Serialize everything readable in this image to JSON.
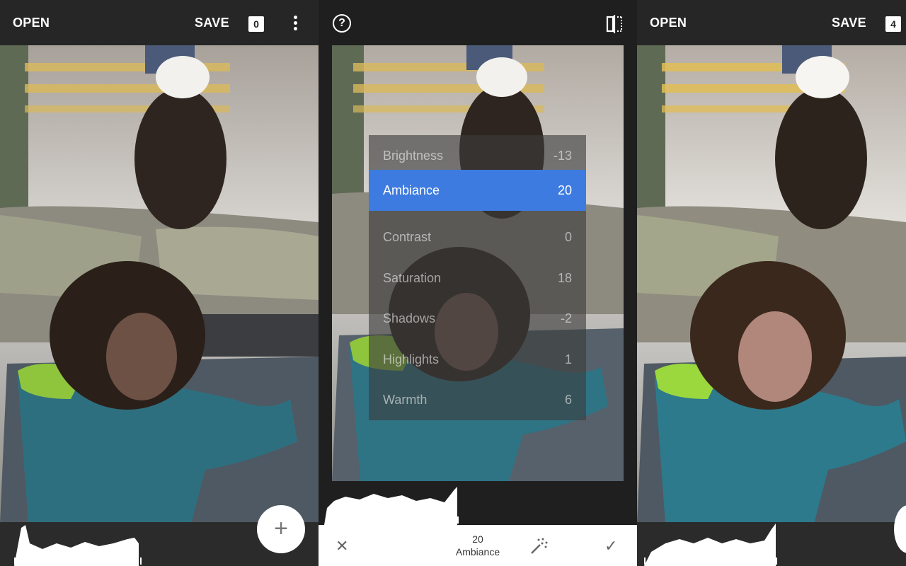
{
  "left_panel": {
    "open_label": "OPEN",
    "save_label": "SAVE",
    "badge": "0",
    "fab_label": "+"
  },
  "middle_panel": {
    "help_label": "?",
    "menu": [
      {
        "label": "Brightness",
        "value": "-13",
        "active": false
      },
      {
        "label": "Ambiance",
        "value": "20",
        "active": true
      },
      {
        "label": "Contrast",
        "value": "0",
        "active": false
      },
      {
        "label": "Saturation",
        "value": "18",
        "active": false
      },
      {
        "label": "Shadows",
        "value": "-2",
        "active": false
      },
      {
        "label": "Highlights",
        "value": "1",
        "active": false
      },
      {
        "label": "Warmth",
        "value": "6",
        "active": false
      }
    ],
    "bottom": {
      "cancel_label": "✕",
      "value": "20",
      "param": "Ambiance",
      "apply_label": "✓"
    }
  },
  "right_panel": {
    "open_label": "OPEN",
    "save_label": "SAVE",
    "badge": "4"
  },
  "colors": {
    "accent": "#3d7be0",
    "topbar": "#262626"
  }
}
